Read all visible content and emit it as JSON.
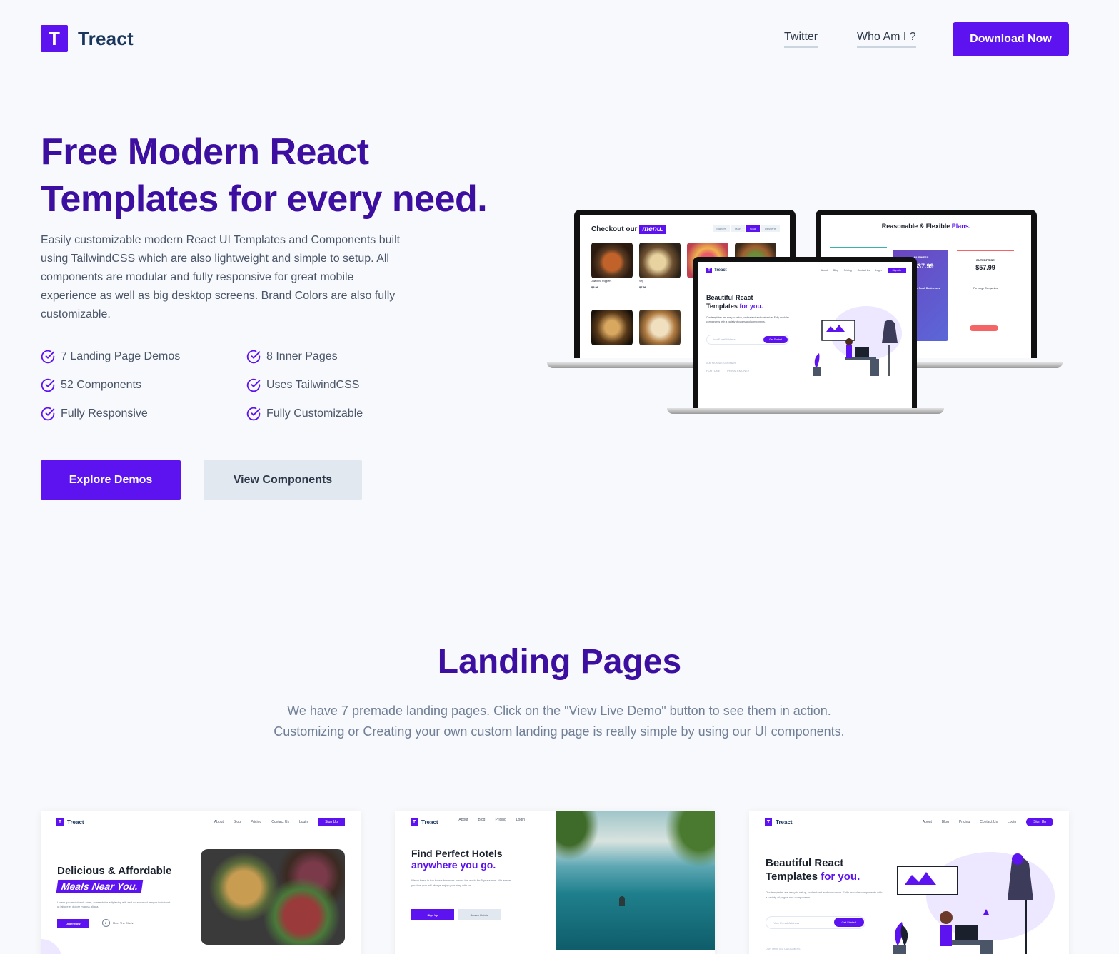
{
  "brand": {
    "logo_letter": "T",
    "name": "Treact"
  },
  "nav": {
    "twitter": "Twitter",
    "who": "Who Am I ?",
    "download": "Download Now"
  },
  "hero": {
    "title_line1": "Free Modern React",
    "title_line2": "Templates for every need.",
    "description": "Easily customizable modern React UI Templates and Components built using TailwindCSS which are also lightweight and simple to setup. All components are modular and fully responsive for great mobile experience as well as big desktop screens. Brand Colors are also fully customizable.",
    "features": [
      "7 Landing Page Demos",
      "8 Inner Pages",
      "52 Components",
      "Uses TailwindCSS",
      "Fully Responsive",
      "Fully Customizable"
    ],
    "explore_button": "Explore Demos",
    "view_button": "View Components"
  },
  "preview": {
    "menu_heading": "Checkout our",
    "menu_highlight": "menu.",
    "menu_tabs": [
      "Starters",
      "Main",
      "Soup",
      "Desserts"
    ],
    "menu_items": [
      {
        "name": "Jalapeno Poppers",
        "price": "$5.99"
      },
      {
        "name": "Veg",
        "price": "$7.99"
      }
    ],
    "plans_heading": "Reasonable & Flexible",
    "plans_highlight": "Plans.",
    "plan_prices": [
      "$37.99",
      "$57.99"
    ],
    "plan_labels": [
      "BUSINESS",
      "ENTERPRISE"
    ],
    "plan_sub": [
      "For Small Businesses",
      "For Large Companies"
    ],
    "hero_heading": "Beautiful React",
    "hero_heading2": "Templates",
    "hero_highlight": "for you.",
    "hero_text": "Our templates are easy to setup, understand and customize. Fully modular components with a variety of pages and components.",
    "email_placeholder": "Your E-mail Address",
    "get_started": "Get Started",
    "trusted": "OUR TRUSTED CUSTOMERS",
    "nav_links": [
      "About",
      "Blog",
      "Pricing",
      "Contact Us",
      "Login"
    ],
    "sign_up": "Sign Up",
    "customers": [
      "FORTUNE",
      "PRIVATEMONEY"
    ]
  },
  "section": {
    "title": "Landing Pages",
    "desc_line1": "We have 7 premade landing pages. Click on the \"View Live Demo\" button to see them in action.",
    "desc_line2": "Customizing or Creating your own custom landing page is really simple by using our UI components."
  },
  "cards": {
    "card1": {
      "title": "Delicious & Affordable",
      "highlight": "Meals Near You.",
      "text": "Lorem ipsum dolor sit amet, consectetur adipiscing elit, sed do eiusmod tempor incididunt ut labore et dolore magna aliqua.",
      "order": "Order Now",
      "meet": "Meet The Chefs"
    },
    "card2": {
      "title": "Find Perfect Hotels",
      "highlight": "anywhere you go.",
      "text": "We've been in the hotels business across the world for 5 years now. We assure you that you will always enjoy your stay with us.",
      "signup": "Sign Up",
      "search": "Search Hotels",
      "nav_links": [
        "About",
        "Blog",
        "Pricing",
        "Login"
      ]
    },
    "card3": {
      "title": "Beautiful React",
      "title2": "Templates",
      "highlight": "for you.",
      "text": "Our templates are easy to setup, understand and customize. Fully modular components with a variety of pages and components.",
      "email": "Your E-mail Address",
      "get_started": "Get Started",
      "trusted": "OUR TRUSTED CUSTOMERS"
    }
  },
  "colors": {
    "primary": "#5d12f0",
    "title": "#3c0fa0",
    "bg": "#f7f9fc"
  }
}
